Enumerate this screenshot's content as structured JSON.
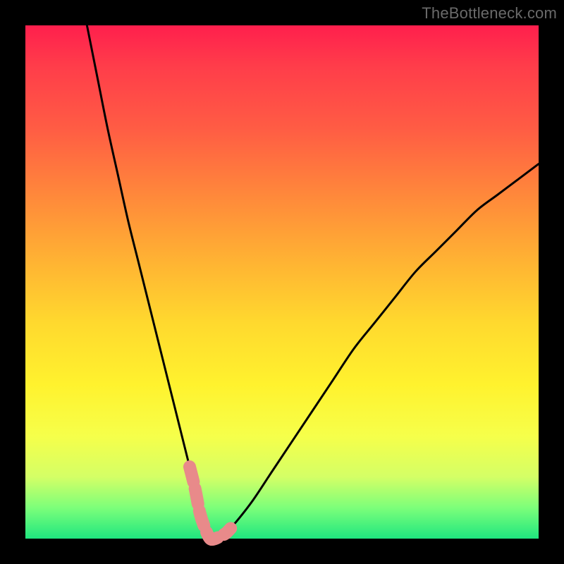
{
  "watermark": "TheBottleneck.com",
  "chart_data": {
    "type": "line",
    "title": "",
    "xlabel": "",
    "ylabel": "",
    "xlim": [
      0,
      100
    ],
    "ylim": [
      0,
      100
    ],
    "series": [
      {
        "name": "bottleneck-curve",
        "x": [
          12,
          14,
          16,
          18,
          20,
          22,
          24,
          26,
          28,
          30,
          32,
          33,
          34,
          35,
          36,
          38,
          40,
          44,
          48,
          52,
          56,
          60,
          64,
          68,
          72,
          76,
          80,
          84,
          88,
          92,
          96,
          100
        ],
        "values": [
          100,
          90,
          80,
          71,
          62,
          54,
          46,
          38,
          30,
          22,
          14,
          10,
          5,
          2,
          0,
          0,
          2,
          7,
          13,
          19,
          25,
          31,
          37,
          42,
          47,
          52,
          56,
          60,
          64,
          67,
          70,
          73
        ]
      }
    ],
    "highlight": {
      "name": "sweet-spot",
      "x": [
        32,
        33,
        34,
        35,
        36,
        37,
        38,
        39,
        40
      ],
      "values": [
        14,
        10,
        5,
        2,
        0,
        0,
        0.5,
        1,
        2
      ],
      "color": "#e88a8a"
    },
    "gradient_stops": [
      {
        "pos": 0.0,
        "color": "#ff1f4d"
      },
      {
        "pos": 0.2,
        "color": "#ff5c44"
      },
      {
        "pos": 0.46,
        "color": "#ffb333"
      },
      {
        "pos": 0.7,
        "color": "#fff22e"
      },
      {
        "pos": 0.88,
        "color": "#d4ff66"
      },
      {
        "pos": 1.0,
        "color": "#1fe67f"
      }
    ]
  }
}
